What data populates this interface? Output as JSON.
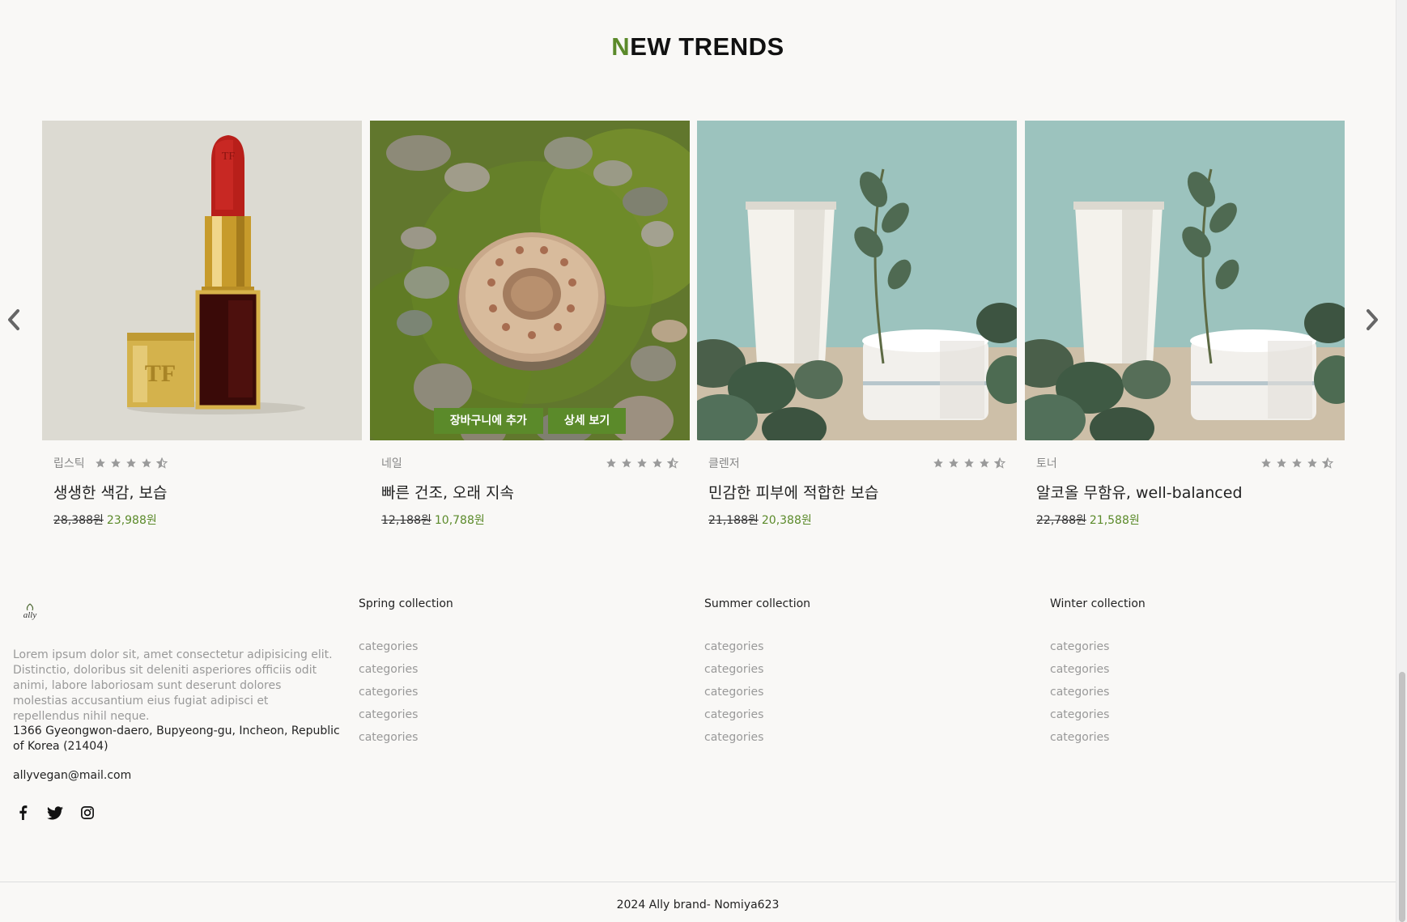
{
  "section": {
    "title_first": "N",
    "title_rest": "EW TRENDS"
  },
  "carousel": {
    "prev_icon": "chevron-left-icon",
    "next_icon": "chevron-right-icon",
    "items": [
      {
        "category": "립스틱",
        "name": "생생한 색감, 보습",
        "price_old": "28,388원",
        "price_new": "23,988원",
        "rating": 4.5,
        "image": "lipstick"
      },
      {
        "category": "네일",
        "name": "빠른 건조, 오래 지속",
        "price_old": "12,188원",
        "price_new": "10,788원",
        "rating": 4.5,
        "image": "compact-on-moss",
        "actions": {
          "add_to_cart": "장바구니에 추가",
          "details": "상세 보기"
        }
      },
      {
        "category": "클렌저",
        "name": "민감한 피부에 적합한 보습",
        "price_old": "21,188원",
        "price_new": "20,388원",
        "rating": 4.5,
        "image": "tube-and-jar"
      },
      {
        "category": "토너",
        "name": "알코올 무함유, well-balanced",
        "price_old": "22,788원",
        "price_new": "21,588원",
        "rating": 4.5,
        "image": "tube-and-jar"
      }
    ]
  },
  "footer": {
    "logo_text": "ally",
    "description": "Lorem ipsum dolor sit, amet consectetur adipisicing elit. Distinctio, doloribus sit deleniti asperiores officiis odit animi, labore laboriosam sunt deserunt dolores molestias accusantium eius fugiat adipisci et repellendus nihil neque.",
    "address": "1366 Gyeongwon-daero, Bupyeong-gu, Incheon, Republic of Korea (21404)",
    "email": "allyvegan@mail.com",
    "social": [
      "facebook-icon",
      "twitter-icon",
      "instagram-icon"
    ],
    "columns": [
      {
        "title": "Spring collection",
        "links": [
          "categories",
          "categories",
          "categories",
          "categories",
          "categories"
        ]
      },
      {
        "title": "Summer collection",
        "links": [
          "categories",
          "categories",
          "categories",
          "categories",
          "categories"
        ]
      },
      {
        "title": "Winter collection",
        "links": [
          "categories",
          "categories",
          "categories",
          "categories",
          "categories"
        ]
      }
    ],
    "copyright": "2024 Ally brand- Nomiya623"
  },
  "colors": {
    "accent": "#5b8a2a",
    "background": "#f9f8f6",
    "muted_text": "#999999"
  }
}
